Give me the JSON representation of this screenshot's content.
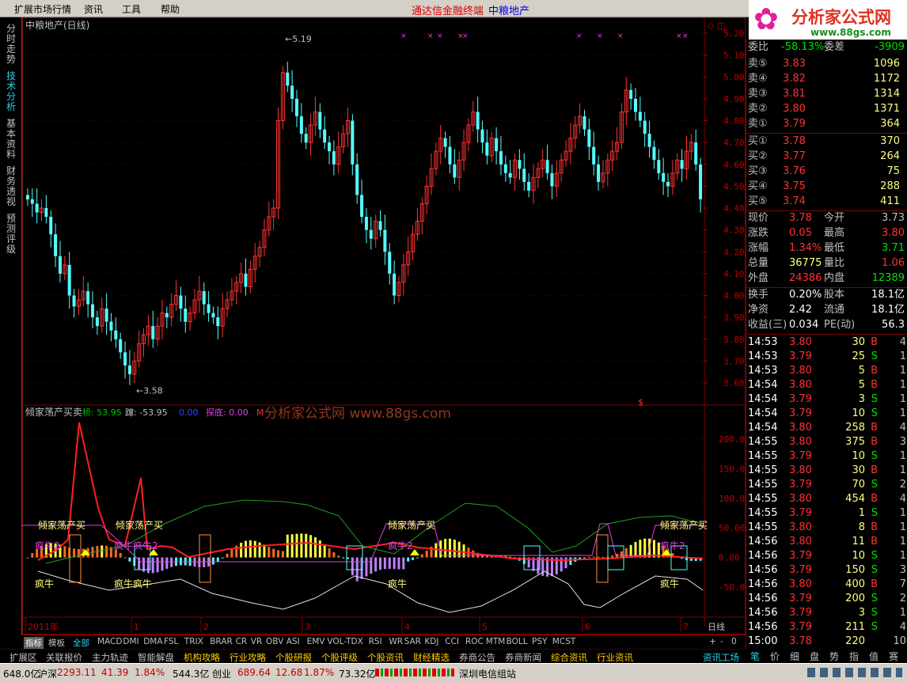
{
  "menu": {
    "items": [
      "扩展市场行情",
      "资讯",
      "工具",
      "帮助"
    ],
    "title_left": "通达信金融终端",
    "title_right": "中粮地产"
  },
  "logo": {
    "text": "分析家公式网",
    "url": "www.88gs.com"
  },
  "left_tabs": [
    "分时走势",
    "技术分析",
    "基本资料",
    "财务透视",
    "预测评级"
  ],
  "chart": {
    "title": "中粮地产(日线)",
    "period_label": "日线",
    "high_label": "5.19",
    "low_label": "3.58",
    "price_ticks": [
      "5.20",
      "5.10",
      "5.00",
      "4.90",
      "4.80",
      "4.70",
      "4.60",
      "4.50",
      "4.40",
      "4.30",
      "4.20",
      "4.10",
      "4.00",
      "3.90",
      "3.80",
      "3.70",
      "3.60"
    ],
    "indicator": {
      "name": "倾家荡产买卖",
      "qiao": "桥: 53.95",
      "jiang": "蹿: -53.95",
      "v": "0.00",
      "tandi": "探底: 0.00",
      "trail": "M",
      "ticks": [
        "200.00",
        "150.00",
        "100.00",
        "50.00",
        "0.00",
        "-50.00"
      ],
      "labels": [
        {
          "t": "倾家荡产买",
          "c": "#ffff80"
        },
        {
          "t": "倾家荡产买",
          "c": "#ffff80"
        },
        {
          "t": "倾家荡产买",
          "c": "#ffff80"
        },
        {
          "t": "倾家荡产买",
          "c": "#ffff80"
        },
        {
          "t": "疯牛2",
          "c": "#e040e0"
        },
        {
          "t": "疯牛疯牛2",
          "c": "#e040e0"
        },
        {
          "t": "疯牛2",
          "c": "#e040e0"
        },
        {
          "t": "疯牛2",
          "c": "#e040e0"
        },
        {
          "t": "疯牛",
          "c": "#ffff80"
        },
        {
          "t": "疯牛疯牛",
          "c": "#ffff80"
        },
        {
          "t": "疯牛",
          "c": "#ffff80"
        },
        {
          "t": "疯牛",
          "c": "#ffff80"
        }
      ]
    },
    "watermark": "分析家公式网 www.88gs.com",
    "dates": [
      "2011年",
      "1",
      "2",
      "3",
      "4",
      "5",
      "6",
      "7"
    ]
  },
  "quote": {
    "wb": {
      "l1": "委比",
      "v1": "-58.13%",
      "l2": "委差",
      "v2": "-3909"
    },
    "asks": [
      {
        "l": "卖⑤",
        "p": "3.83",
        "v": "1096"
      },
      {
        "l": "卖④",
        "p": "3.82",
        "v": "1172"
      },
      {
        "l": "卖③",
        "p": "3.81",
        "v": "1314"
      },
      {
        "l": "卖②",
        "p": "3.80",
        "v": "1371"
      },
      {
        "l": "卖①",
        "p": "3.79",
        "v": "364"
      }
    ],
    "bids": [
      {
        "l": "买①",
        "p": "3.78",
        "v": "370"
      },
      {
        "l": "买②",
        "p": "3.77",
        "v": "264"
      },
      {
        "l": "买③",
        "p": "3.76",
        "v": "75"
      },
      {
        "l": "买④",
        "p": "3.75",
        "v": "288"
      },
      {
        "l": "买⑤",
        "p": "3.74",
        "v": "411"
      }
    ],
    "stats": [
      {
        "l1": "现价",
        "v1": "3.78",
        "c1": "#ff3232",
        "l2": "今开",
        "v2": "3.73",
        "c2": "#c0c0c0"
      },
      {
        "l1": "涨跌",
        "v1": "0.05",
        "c1": "#ff3232",
        "l2": "最高",
        "v2": "3.80",
        "c2": "#ff3232"
      },
      {
        "l1": "涨幅",
        "v1": "1.34%",
        "c1": "#ff3232",
        "l2": "最低",
        "v2": "3.71",
        "c2": "#00e000"
      },
      {
        "l1": "总量",
        "v1": "36775",
        "c1": "#ffff80",
        "l2": "量比",
        "v2": "1.06",
        "c2": "#ff3232"
      },
      {
        "l1": "外盘",
        "v1": "24386",
        "c1": "#ff3232",
        "l2": "内盘",
        "v2": "12389",
        "c2": "#00e000"
      }
    ],
    "fund": [
      {
        "l1": "换手",
        "v1": "0.20%",
        "l2": "股本",
        "v2": "18.1亿"
      },
      {
        "l1": "净资",
        "v1": "2.42",
        "l2": "流通",
        "v2": "18.1亿"
      },
      {
        "l1": "收益(三)",
        "v1": "0.034",
        "l2": "PE(动)",
        "v2": "56.3"
      }
    ]
  },
  "ticks_list": [
    {
      "t": "14:53",
      "p": "3.80",
      "v": "30",
      "s": "B",
      "n": "4"
    },
    {
      "t": "14:53",
      "p": "3.79",
      "v": "25",
      "s": "S",
      "n": "1"
    },
    {
      "t": "14:53",
      "p": "3.80",
      "v": "5",
      "s": "B",
      "n": "1"
    },
    {
      "t": "14:54",
      "p": "3.80",
      "v": "5",
      "s": "B",
      "n": "1"
    },
    {
      "t": "14:54",
      "p": "3.79",
      "v": "3",
      "s": "S",
      "n": "1"
    },
    {
      "t": "14:54",
      "p": "3.79",
      "v": "10",
      "s": "S",
      "n": "1"
    },
    {
      "t": "14:54",
      "p": "3.80",
      "v": "258",
      "s": "B",
      "n": "4"
    },
    {
      "t": "14:55",
      "p": "3.80",
      "v": "375",
      "s": "B",
      "n": "3"
    },
    {
      "t": "14:55",
      "p": "3.79",
      "v": "10",
      "s": "S",
      "n": "1"
    },
    {
      "t": "14:55",
      "p": "3.80",
      "v": "30",
      "s": "B",
      "n": "1"
    },
    {
      "t": "14:55",
      "p": "3.79",
      "v": "70",
      "s": "S",
      "n": "2"
    },
    {
      "t": "14:55",
      "p": "3.80",
      "v": "454",
      "s": "B",
      "n": "4"
    },
    {
      "t": "14:55",
      "p": "3.79",
      "v": "1",
      "s": "S",
      "n": "1"
    },
    {
      "t": "14:55",
      "p": "3.80",
      "v": "8",
      "s": "B",
      "n": "1"
    },
    {
      "t": "14:56",
      "p": "3.80",
      "v": "11",
      "s": "B",
      "n": "1"
    },
    {
      "t": "14:56",
      "p": "3.79",
      "v": "10",
      "s": "S",
      "n": "1"
    },
    {
      "t": "14:56",
      "p": "3.79",
      "v": "150",
      "s": "S",
      "n": "3"
    },
    {
      "t": "14:56",
      "p": "3.80",
      "v": "400",
      "s": "B",
      "n": "7"
    },
    {
      "t": "14:56",
      "p": "3.79",
      "v": "200",
      "s": "S",
      "n": "2"
    },
    {
      "t": "14:56",
      "p": "3.79",
      "v": "3",
      "s": "S",
      "n": "1"
    },
    {
      "t": "14:56",
      "p": "3.79",
      "v": "211",
      "s": "S",
      "n": "4"
    },
    {
      "t": "15:00",
      "p": "3.78",
      "v": "220",
      "s": "",
      "n": "10"
    }
  ],
  "right_tabs": [
    "笔",
    "价",
    "细",
    "盘",
    "势",
    "指",
    "值",
    "赛"
  ],
  "indicator_tabs": [
    "指标",
    "模板",
    "全部",
    "MACD",
    "DMI",
    "DMA",
    "FSL",
    "TRIX",
    "BRAR",
    "CR",
    "VR",
    "OBV",
    "ASI",
    "EMV",
    "VOL-TDX",
    "RSI",
    "WR",
    "SAR",
    "KDJ",
    "CCI",
    "ROC",
    "MTM",
    "BOLL",
    "PSY",
    "MCST"
  ],
  "indicator_tabs_right": [
    "+",
    "-",
    "0"
  ],
  "bottom_tabs": [
    {
      "t": "扩展区",
      "c": "#c0c0c0"
    },
    {
      "t": "关联报价",
      "c": "#c0c0c0"
    },
    {
      "t": "主力轨迹",
      "c": "#c0c0c0"
    },
    {
      "t": "智能解盘",
      "c": "#c0c0c0"
    },
    {
      "t": "机构攻略",
      "c": "#ffcc00"
    },
    {
      "t": "行业攻略",
      "c": "#ffcc00"
    },
    {
      "t": "个股研报",
      "c": "#ffcc00"
    },
    {
      "t": "个股评级",
      "c": "#ffcc00"
    },
    {
      "t": "个股资讯",
      "c": "#ffcc00"
    },
    {
      "t": "财经精选",
      "c": "#ffcc00"
    },
    {
      "t": "券商公告",
      "c": "#c0c0c0"
    },
    {
      "t": "券商新闻",
      "c": "#c0c0c0"
    },
    {
      "t": "综合资讯",
      "c": "#ffcc00"
    },
    {
      "t": "行业资讯",
      "c": "#ffcc00"
    },
    {
      "t": "资讯工场",
      "c": "#29d1ea"
    }
  ],
  "status": {
    "s0": "648.0亿",
    "s1": "沪深",
    "s2": "2293.11",
    "s3": "41.39",
    "s4": "1.84%",
    "s5": "544.3亿",
    "s6": "创业",
    "s7": "689.64",
    "s8": "12.68",
    "s9": "1.87%",
    "s10": "73.32亿",
    "s11": "深圳电信组站"
  }
}
